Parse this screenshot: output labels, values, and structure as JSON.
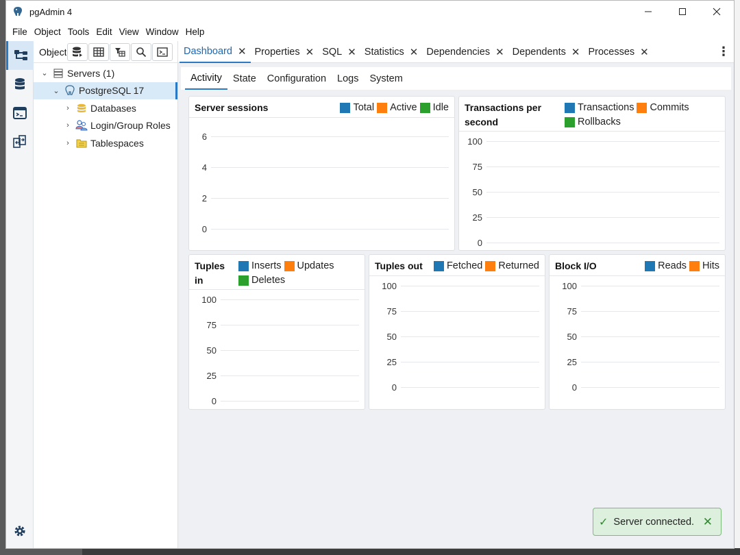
{
  "window": {
    "title": "pgAdmin 4"
  },
  "menu": [
    "File",
    "Object",
    "Tools",
    "Edit",
    "View",
    "Window",
    "Help"
  ],
  "object_explorer": {
    "tab_label": "Object Explorer",
    "tree": [
      {
        "label": "Servers (1)",
        "level": 0,
        "expanded": true
      },
      {
        "label": "PostgreSQL 17",
        "level": 1,
        "expanded": true,
        "selected": true
      },
      {
        "label": "Databases",
        "level": 2,
        "expanded": false
      },
      {
        "label": "Login/Group Roles",
        "level": 2,
        "expanded": false
      },
      {
        "label": "Tablespaces",
        "level": 2,
        "expanded": false
      }
    ]
  },
  "tabs": [
    {
      "label": "Dashboard",
      "active": true
    },
    {
      "label": "Properties"
    },
    {
      "label": "SQL"
    },
    {
      "label": "Statistics"
    },
    {
      "label": "Dependencies"
    },
    {
      "label": "Dependents"
    },
    {
      "label": "Processes"
    }
  ],
  "subtabs": [
    {
      "label": "Activity",
      "active": true
    },
    {
      "label": "State"
    },
    {
      "label": "Configuration"
    },
    {
      "label": "Logs"
    },
    {
      "label": "System"
    }
  ],
  "colors": {
    "blue": "#1f77b4",
    "orange": "#ff7f0e",
    "green": "#2ca02c",
    "accent": "#2b78c5"
  },
  "charts": {
    "server_sessions": {
      "title": "Server sessions",
      "legend": [
        {
          "name": "Total",
          "color": "#1f77b4"
        },
        {
          "name": "Active",
          "color": "#ff7f0e"
        },
        {
          "name": "Idle",
          "color": "#2ca02c"
        }
      ],
      "ticks": [
        "6",
        "4",
        "2",
        "0"
      ]
    },
    "transactions": {
      "title": "Transactions per second",
      "legend": [
        {
          "name": "Transactions",
          "color": "#1f77b4"
        },
        {
          "name": "Commits",
          "color": "#ff7f0e"
        },
        {
          "name": "Rollbacks",
          "color": "#2ca02c"
        }
      ],
      "ticks": [
        "100",
        "75",
        "50",
        "25",
        "0"
      ]
    },
    "tuples_in": {
      "title": "Tuples in",
      "legend": [
        {
          "name": "Inserts",
          "color": "#1f77b4"
        },
        {
          "name": "Updates",
          "color": "#ff7f0e"
        },
        {
          "name": "Deletes",
          "color": "#2ca02c"
        }
      ],
      "ticks": [
        "100",
        "75",
        "50",
        "25",
        "0"
      ]
    },
    "tuples_out": {
      "title": "Tuples out",
      "legend": [
        {
          "name": "Fetched",
          "color": "#1f77b4"
        },
        {
          "name": "Returned",
          "color": "#ff7f0e"
        }
      ],
      "ticks": [
        "100",
        "75",
        "50",
        "25",
        "0"
      ]
    },
    "block_io": {
      "title": "Block I/O",
      "legend": [
        {
          "name": "Reads",
          "color": "#1f77b4"
        },
        {
          "name": "Hits",
          "color": "#ff7f0e"
        }
      ],
      "ticks": [
        "100",
        "75",
        "50",
        "25",
        "0"
      ]
    }
  },
  "toast": {
    "message": "Server connected."
  }
}
